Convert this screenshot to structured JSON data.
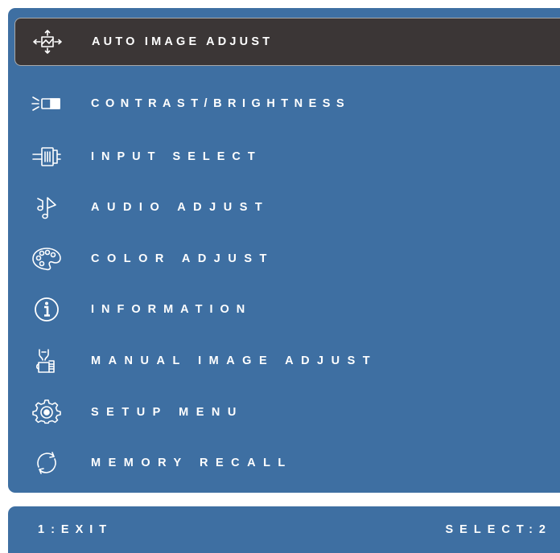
{
  "menu": {
    "items": [
      {
        "label": "AUTO IMAGE ADJUST",
        "icon": "auto-adjust-icon",
        "selected": true
      },
      {
        "label": "CONTRAST/BRIGHTNESS",
        "icon": "contrast-brightness-icon"
      },
      {
        "label": "INPUT SELECT",
        "icon": "input-select-icon"
      },
      {
        "label": "AUDIO ADJUST",
        "icon": "audio-icon"
      },
      {
        "label": "COLOR ADJUST",
        "icon": "color-palette-icon"
      },
      {
        "label": "INFORMATION",
        "icon": "information-icon"
      },
      {
        "label": "MANUAL IMAGE ADJUST",
        "icon": "manual-adjust-icon"
      },
      {
        "label": "SETUP MENU",
        "icon": "gear-icon"
      },
      {
        "label": "MEMORY RECALL",
        "icon": "recall-icon"
      }
    ]
  },
  "footer": {
    "exit_label": "1:EXIT",
    "select_label": "SELECT:2"
  },
  "colors": {
    "panel": "#3e6fa2",
    "selected_bg": "#3b3636",
    "text": "#ffffff"
  }
}
